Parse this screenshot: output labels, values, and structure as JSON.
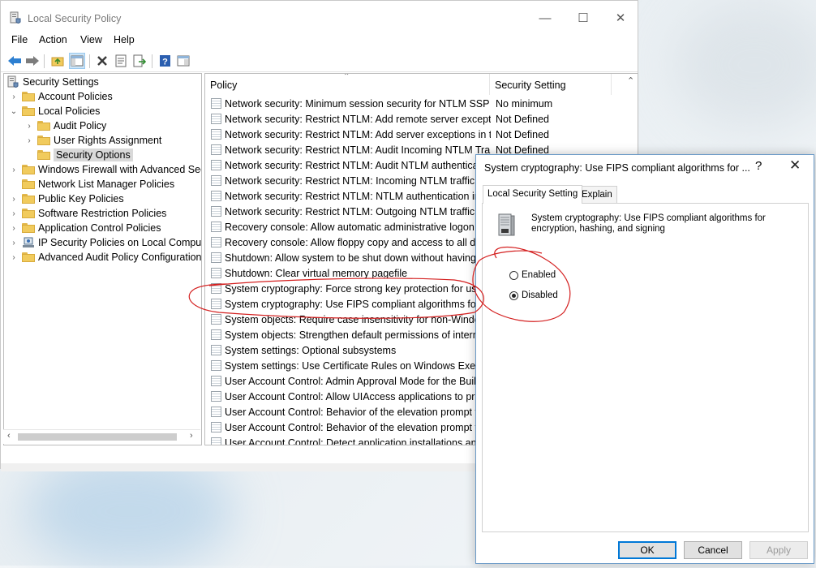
{
  "window": {
    "title": "Local Security Policy",
    "controls": {
      "minimize": "—",
      "maximize": "☐",
      "close": "✕"
    }
  },
  "menu": [
    "File",
    "Action",
    "View",
    "Help"
  ],
  "tree": {
    "items": [
      {
        "label": "Security Settings",
        "level": 0,
        "expander": "",
        "selected": false
      },
      {
        "label": "Account Policies",
        "level": 1,
        "expander": "›",
        "selected": false
      },
      {
        "label": "Local Policies",
        "level": 1,
        "expander": "⌄",
        "selected": false
      },
      {
        "label": "Audit Policy",
        "level": 2,
        "expander": "›",
        "selected": false
      },
      {
        "label": "User Rights Assignment",
        "level": 2,
        "expander": "›",
        "selected": false
      },
      {
        "label": "Security Options",
        "level": 2,
        "expander": "",
        "selected": true
      },
      {
        "label": "Windows Firewall with Advanced Secu",
        "level": 1,
        "expander": "›",
        "selected": false
      },
      {
        "label": "Network List Manager Policies",
        "level": 1,
        "expander": "",
        "selected": false
      },
      {
        "label": "Public Key Policies",
        "level": 1,
        "expander": "›",
        "selected": false
      },
      {
        "label": "Software Restriction Policies",
        "level": 1,
        "expander": "›",
        "selected": false
      },
      {
        "label": "Application Control Policies",
        "level": 1,
        "expander": "›",
        "selected": false
      },
      {
        "label": "IP Security Policies on Local Compute",
        "level": 1,
        "expander": "›",
        "selected": false
      },
      {
        "label": "Advanced Audit Policy Configuration",
        "level": 1,
        "expander": "›",
        "selected": false
      }
    ]
  },
  "list": {
    "columns": {
      "policy": "Policy",
      "setting": "Security Setting"
    },
    "rows": [
      {
        "policy": "Network security: Minimum session security for NTLM SSP ...",
        "setting": "No minimum"
      },
      {
        "policy": "Network security: Restrict NTLM: Add remote server excepti...",
        "setting": "Not Defined"
      },
      {
        "policy": "Network security: Restrict NTLM: Add server exceptions in t...",
        "setting": "Not Defined"
      },
      {
        "policy": "Network security: Restrict NTLM: Audit Incoming NTLM Tra...",
        "setting": "Not Defined"
      },
      {
        "policy": "Network security: Restrict NTLM: Audit NTLM authenticatio",
        "setting": ""
      },
      {
        "policy": "Network security: Restrict NTLM: Incoming NTLM traffic",
        "setting": ""
      },
      {
        "policy": "Network security: Restrict NTLM: NTLM authentication in th",
        "setting": ""
      },
      {
        "policy": "Network security: Restrict NTLM: Outgoing NTLM traffic to",
        "setting": ""
      },
      {
        "policy": "Recovery console: Allow automatic administrative logon",
        "setting": ""
      },
      {
        "policy": "Recovery console: Allow floppy copy and access to all drive",
        "setting": ""
      },
      {
        "policy": "Shutdown: Allow system to be shut down without having to",
        "setting": ""
      },
      {
        "policy": "Shutdown: Clear virtual memory pagefile",
        "setting": ""
      },
      {
        "policy": "System cryptography: Force strong key protection for user k",
        "setting": ""
      },
      {
        "policy": "System cryptography: Use FIPS compliant algorithms for en",
        "setting": ""
      },
      {
        "policy": "System objects: Require case insensitivity for non-Windows",
        "setting": ""
      },
      {
        "policy": "System objects: Strengthen default permissions of internal s",
        "setting": ""
      },
      {
        "policy": "System settings: Optional subsystems",
        "setting": ""
      },
      {
        "policy": "System settings: Use Certificate Rules on Windows Executab",
        "setting": ""
      },
      {
        "policy": "User Account Control: Admin Approval Mode for the Built-",
        "setting": ""
      },
      {
        "policy": "User Account Control: Allow UIAccess applications to prom",
        "setting": ""
      },
      {
        "policy": "User Account Control: Behavior of the elevation prompt for",
        "setting": ""
      },
      {
        "policy": "User Account Control: Behavior of the elevation prompt for",
        "setting": ""
      },
      {
        "policy": "User Account Control: Detect application installations and r",
        "setting": ""
      }
    ]
  },
  "dialog": {
    "title": "System cryptography: Use FIPS compliant algorithms for ...",
    "help": "?",
    "close": "✕",
    "tabs": [
      "Local Security Setting",
      "Explain"
    ],
    "description": "System cryptography: Use FIPS compliant algorithms for encryption, hashing, and signing",
    "options": [
      {
        "label": "Enabled",
        "checked": false
      },
      {
        "label": "Disabled",
        "checked": true
      }
    ],
    "buttons": {
      "ok": "OK",
      "cancel": "Cancel",
      "apply": "Apply"
    }
  },
  "colors": {
    "annotation": "#d42020",
    "selection": "#d9d9d9",
    "accent": "#0078d7"
  },
  "icons": {
    "back": "back-arrow-icon",
    "forward": "forward-arrow-icon",
    "up": "up-folder-icon",
    "show-hide": "console-tree-icon",
    "delete": "delete-icon",
    "properties": "properties-icon",
    "export": "export-list-icon",
    "help": "help-icon",
    "extra": "extended-view-icon"
  }
}
